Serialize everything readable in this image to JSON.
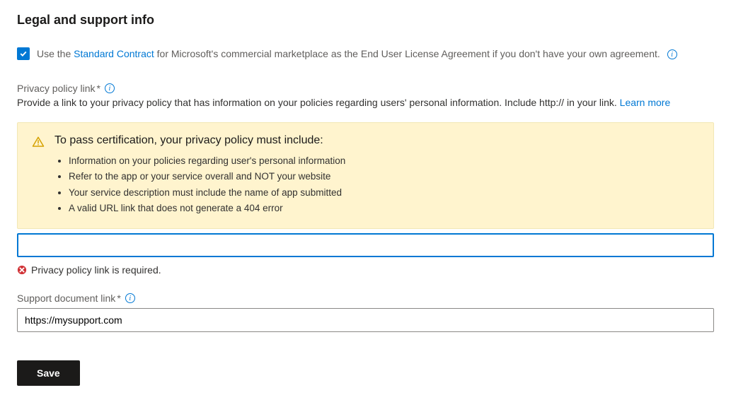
{
  "section_title": "Legal and support info",
  "contract": {
    "checked": true,
    "prefix": "Use the ",
    "link_text": "Standard Contract",
    "suffix": " for Microsoft's commercial marketplace as the End User License Agreement if you don't have your own agreement."
  },
  "privacy": {
    "label": "Privacy policy link",
    "required_mark": "*",
    "description_prefix": "Provide a link to your privacy policy that has information on your policies regarding users' personal information. Include http:// in your link. ",
    "learn_more": "Learn more",
    "value": "",
    "error": "Privacy policy link is required."
  },
  "alert": {
    "heading": "To pass certification, your privacy policy must include:",
    "items": [
      "Information on your policies regarding user's personal information",
      "Refer to the app or your service overall and NOT your website",
      "Your service description must include the name of app submitted",
      "A valid URL link that does not generate a 404 error"
    ]
  },
  "support": {
    "label": "Support document link",
    "required_mark": "*",
    "value": "https://mysupport.com"
  },
  "save_label": "Save"
}
